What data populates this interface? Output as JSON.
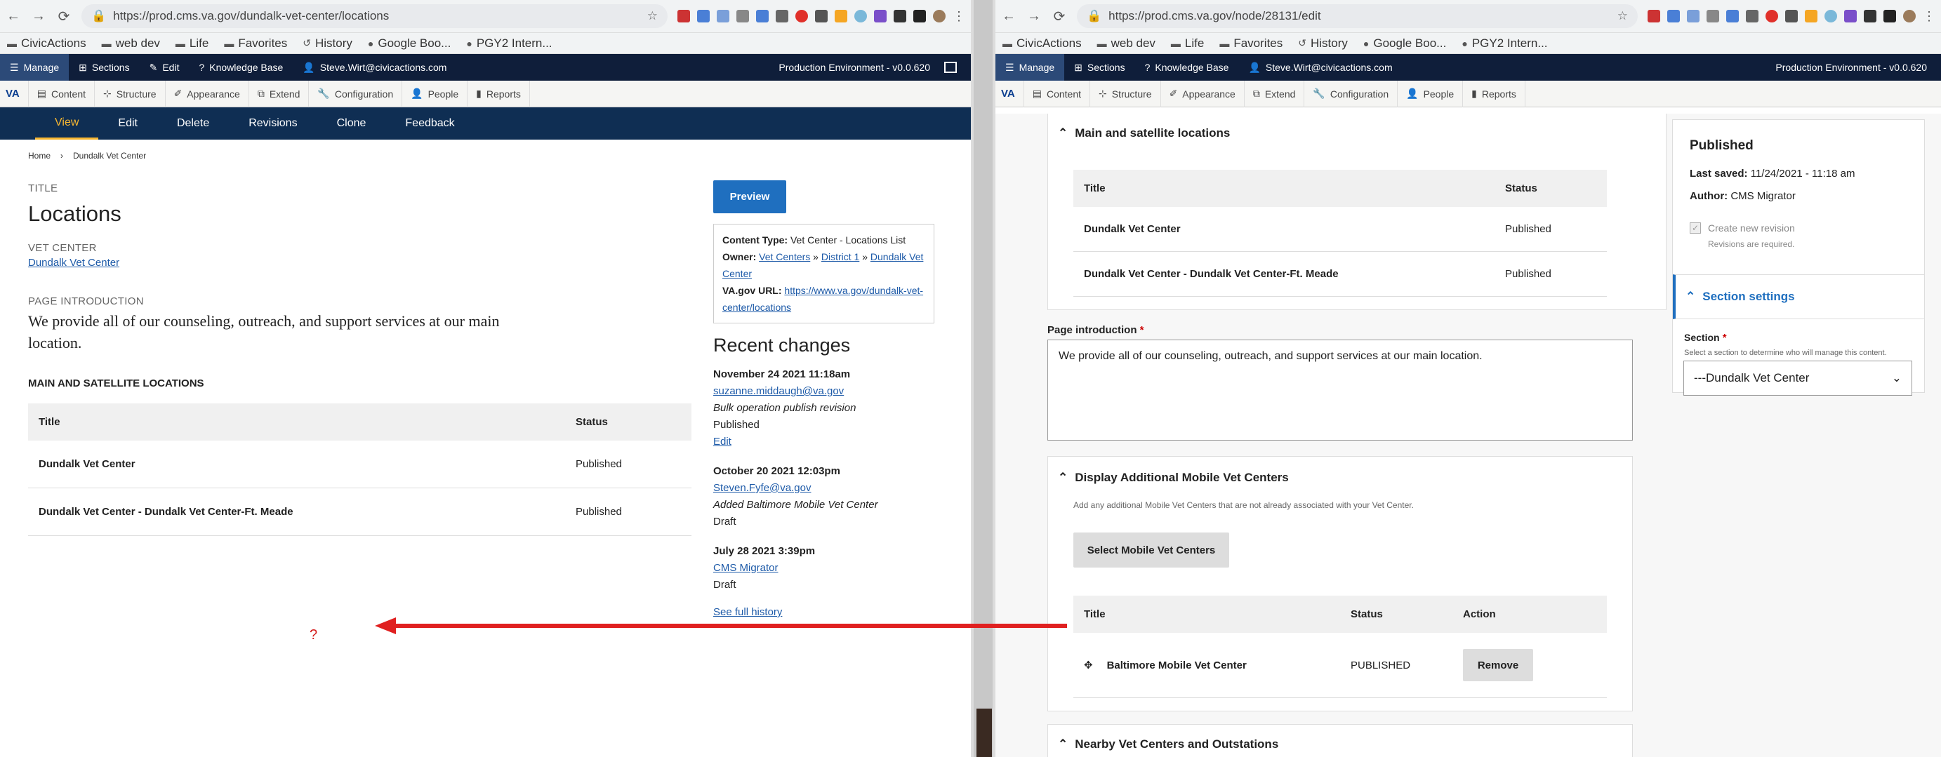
{
  "left": {
    "url": "https://prod.cms.va.gov/dundalk-vet-center/locations",
    "bookmarks": [
      "CivicActions",
      "web dev",
      "Life",
      "Favorites",
      "History",
      "Google Boo...",
      "PGY2 Intern..."
    ],
    "toolbar": {
      "manage": "Manage",
      "sections": "Sections",
      "edit": "Edit",
      "kb": "Knowledge Base",
      "user": "Steve.Wirt@civicactions.com",
      "env": "Production Environment - v0.0.620"
    },
    "admin": {
      "va": "VA",
      "items": [
        "Content",
        "Structure",
        "Appearance",
        "Extend",
        "Configuration",
        "People",
        "Reports"
      ]
    },
    "tabs": [
      "View",
      "Edit",
      "Delete",
      "Revisions",
      "Clone",
      "Feedback"
    ],
    "breadcrumb": {
      "home": "Home",
      "sep": "›",
      "current": "Dundalk Vet Center"
    },
    "title_label": "TITLE",
    "title": "Locations",
    "vet_center_label": "VET CENTER",
    "vet_center": "Dundalk Vet Center",
    "intro_label": "PAGE INTRODUCTION",
    "intro": "We provide all of our counseling, outreach, and support services at our main location.",
    "locations_label": "MAIN AND SATELLITE LOCATIONS",
    "table": {
      "headers": [
        "Title",
        "Status"
      ],
      "rows": [
        {
          "title": "Dundalk Vet Center",
          "status": "Published"
        },
        {
          "title": "Dundalk Vet Center - Dundalk Vet Center-Ft. Meade",
          "status": "Published"
        }
      ]
    },
    "preview": "Preview",
    "meta": {
      "ct_label": "Content Type:",
      "ct": "Vet Center - Locations List",
      "owner_label": "Owner:",
      "owner1": "Vet Centers",
      "sep": "»",
      "owner2": "District 1",
      "owner3": "Dundalk Vet Center",
      "url_label": "VA.gov URL:",
      "url": "https://www.va.gov/dundalk-vet-center/locations"
    },
    "recent_title": "Recent changes",
    "revisions": [
      {
        "date": "November 24 2021 11:18am",
        "user": "suzanne.middaugh@va.gov",
        "msg": "Bulk operation publish revision",
        "state": "Published",
        "link": "Edit"
      },
      {
        "date": "October 20 2021 12:03pm",
        "user": "Steven.Fyfe@va.gov",
        "msg": "Added Baltimore Mobile Vet Center",
        "state": "Draft"
      },
      {
        "date": "July 28 2021 3:39pm",
        "user": "CMS Migrator",
        "state": "Draft"
      }
    ],
    "full_history": "See full history",
    "annotation": "?"
  },
  "right": {
    "url": "https://prod.cms.va.gov/node/28131/edit",
    "bookmarks": [
      "CivicActions",
      "web dev",
      "Life",
      "Favorites",
      "History",
      "Google Boo...",
      "PGY2 Intern..."
    ],
    "toolbar": {
      "manage": "Manage",
      "sections": "Sections",
      "kb": "Knowledge Base",
      "user": "Steve.Wirt@civicactions.com",
      "env": "Production Environment - v0.0.620"
    },
    "admin": {
      "va": "VA",
      "items": [
        "Content",
        "Structure",
        "Appearance",
        "Extend",
        "Configuration",
        "People",
        "Reports"
      ]
    },
    "locations_panel": {
      "title": "Main and satellite locations",
      "headers": [
        "Title",
        "Status"
      ],
      "rows": [
        {
          "title": "Dundalk Vet Center",
          "status": "Published"
        },
        {
          "title": "Dundalk Vet Center - Dundalk Vet Center-Ft. Meade",
          "status": "Published"
        }
      ]
    },
    "intro_label": "Page introduction",
    "required_mark": "*",
    "intro_value": "We provide all of our counseling, outreach, and support services at our main location.",
    "mobile_panel": {
      "title": "Display Additional Mobile Vet Centers",
      "desc": "Add any additional Mobile Vet Centers that are not already associated with your Vet Center.",
      "button": "Select Mobile Vet Centers",
      "headers": [
        "Title",
        "Status",
        "Action"
      ],
      "row": {
        "title": "Baltimore Mobile Vet Center",
        "status": "PUBLISHED",
        "action": "Remove"
      }
    },
    "nearby_title": "Nearby Vet Centers and Outstations",
    "status_panel": {
      "title": "Published",
      "saved_label": "Last saved:",
      "saved": "11/24/2021 - 11:18 am",
      "author_label": "Author:",
      "author": "CMS Migrator",
      "revision_label": "Create new revision",
      "revision_note": "Revisions are required."
    },
    "section_settings": {
      "title": "Section settings",
      "label": "Section",
      "desc": "Select a section to determine who will manage this content.",
      "value": "---Dundalk Vet Center"
    }
  }
}
